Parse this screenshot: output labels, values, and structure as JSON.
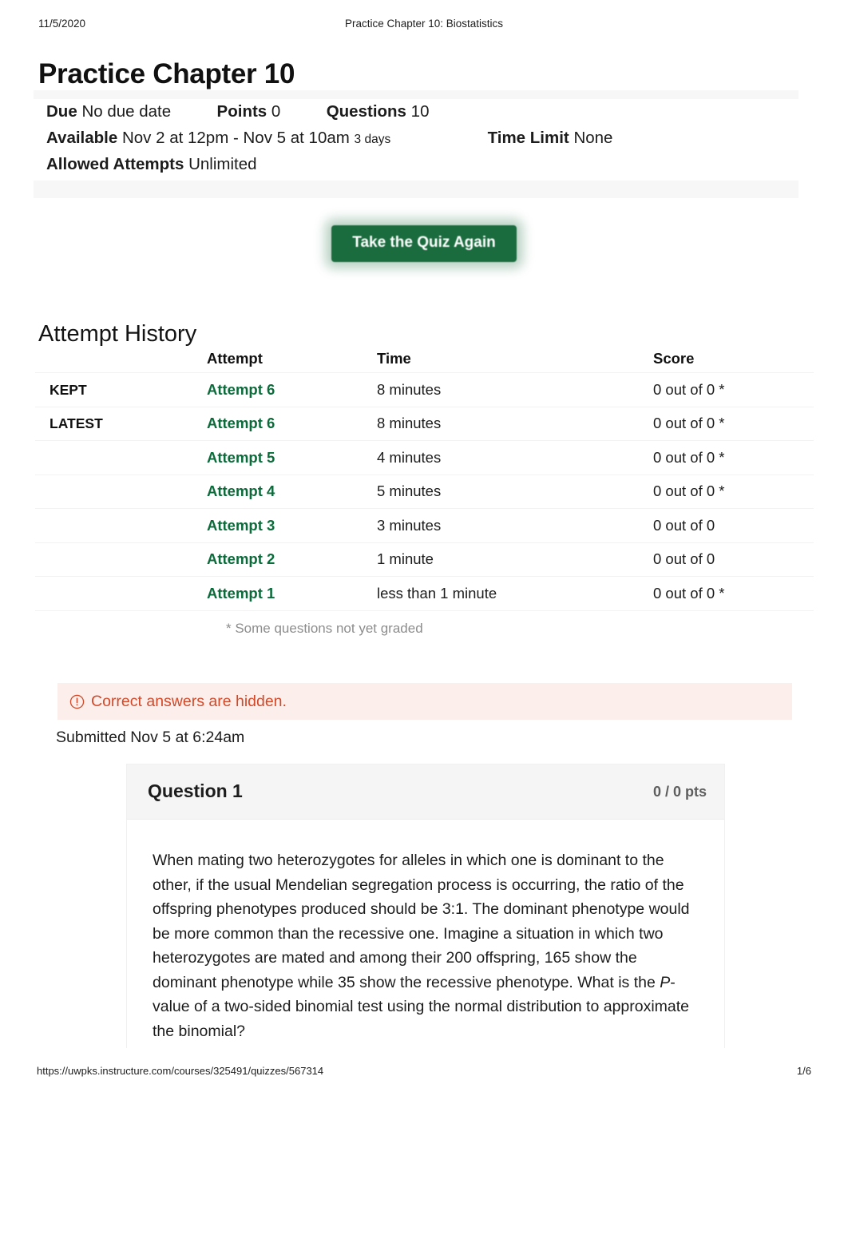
{
  "print_header": {
    "date": "11/5/2020",
    "doc_title": "Practice Chapter 10: Biostatistics"
  },
  "page_title": "Practice Chapter 10",
  "quiz_details": {
    "due_label": "Due",
    "due_value": "No due date",
    "points_label": "Points",
    "points_value": "0",
    "questions_label": "Questions",
    "questions_value": "10",
    "available_label": "Available",
    "available_value": "Nov 2 at 12pm - Nov 5 at 10am",
    "available_duration": "3 days",
    "time_limit_label": "Time Limit",
    "time_limit_value": "None",
    "allowed_attempts_label": "Allowed Attempts",
    "allowed_attempts_value": "Unlimited"
  },
  "take_quiz_button": {
    "label": "Take the Quiz Again",
    "color": "#1a6b3e"
  },
  "attempt_history": {
    "heading": "Attempt History",
    "columns": {
      "kept": "",
      "attempt": "Attempt",
      "time": "Time",
      "score": "Score"
    },
    "rows": [
      {
        "tag": "KEPT",
        "attempt": "Attempt 6",
        "time": "8 minutes",
        "score": "0 out of 0 *"
      },
      {
        "tag": "LATEST",
        "attempt": "Attempt 6",
        "time": "8 minutes",
        "score": "0 out of 0 *"
      },
      {
        "tag": "",
        "attempt": "Attempt 5",
        "time": "4 minutes",
        "score": "0 out of 0 *"
      },
      {
        "tag": "",
        "attempt": "Attempt 4",
        "time": "5 minutes",
        "score": "0 out of 0 *"
      },
      {
        "tag": "",
        "attempt": "Attempt 3",
        "time": "3 minutes",
        "score": "0 out of 0"
      },
      {
        "tag": "",
        "attempt": "Attempt 2",
        "time": "1 minute",
        "score": "0 out of 0"
      },
      {
        "tag": "",
        "attempt": "Attempt 1",
        "time": "less than 1 minute",
        "score": "0 out of 0 *"
      }
    ],
    "grade_note": "* Some questions not yet graded",
    "link_color": "#0b6b3a"
  },
  "answers_alert": {
    "icon": "exclamation-circle-icon",
    "text": "Correct answers are hidden.",
    "color": "#d2492a",
    "background": "#fcefeb"
  },
  "submitted": "Submitted Nov 5 at 6:24am",
  "question": {
    "title": "Question 1",
    "points": "0 / 0 pts",
    "text_part1": "When mating two heterozygotes for alleles in which one is dominant to the other, if the usual Mendelian segregation process is occurring, the ratio of the offspring phenotypes produced should be 3:1. The dominant phenotype would be more common than the recessive one. Imagine a situation in which two heterozygotes are mated and among their 200 offspring, 165 show the dominant phenotype while 35 show the recessive phenotype. What is the ",
    "text_italic": "P",
    "text_part2": "-value of a two-sided binomial test using the normal distribution to approximate the binomial?"
  },
  "print_footer": {
    "url": "https://uwpks.instructure.com/courses/325491/quizzes/567314",
    "page": "1/6"
  }
}
